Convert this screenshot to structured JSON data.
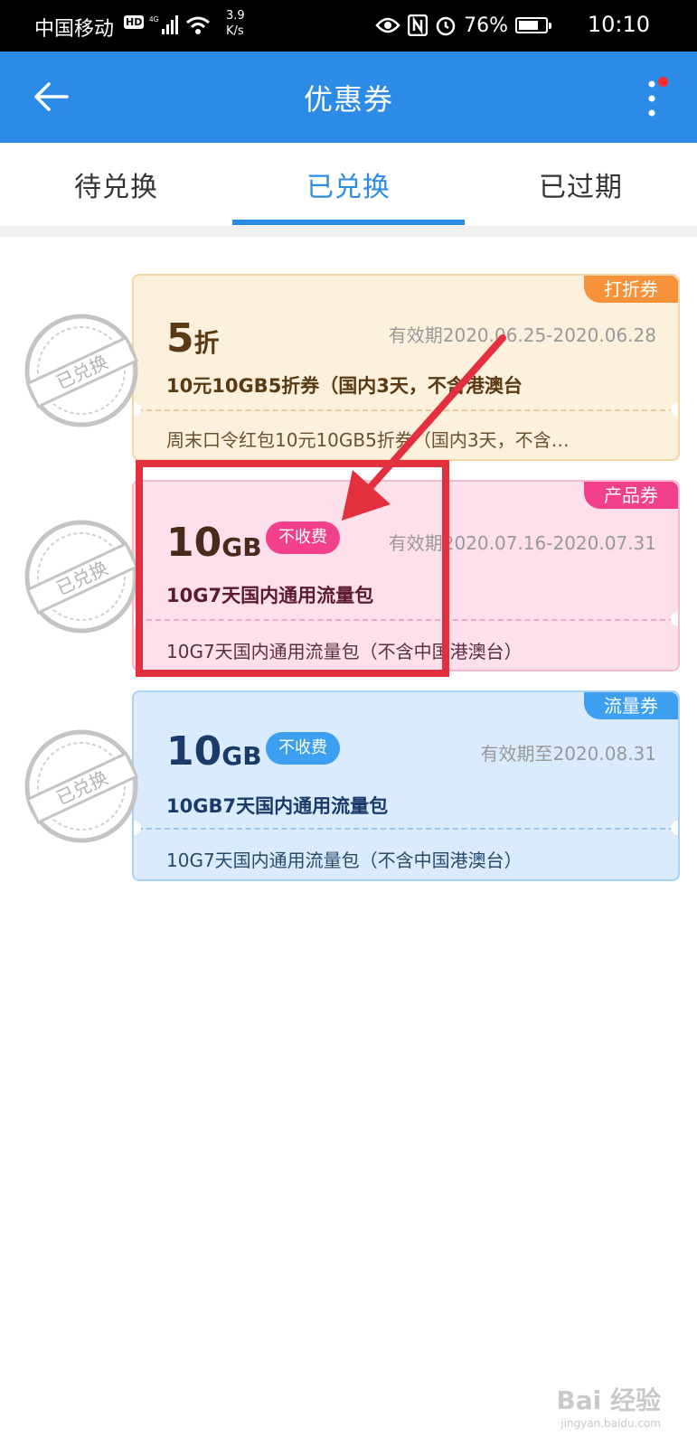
{
  "status_bar": {
    "carrier": "中国移动",
    "hd_label": "HD",
    "speed_value": "3.9",
    "speed_unit": "K/s",
    "battery": "76%",
    "battery_level": 0.76,
    "time": "10:10"
  },
  "header": {
    "title": "优惠券",
    "back_icon": "back-arrow-icon",
    "more_icon": "more-vertical-icon",
    "accent_color": "#2b8be6"
  },
  "tabs": [
    {
      "label": "待兑换",
      "active": false
    },
    {
      "label": "已兑换",
      "active": true
    },
    {
      "label": "已过期",
      "active": false
    }
  ],
  "stamp_label": "已兑换",
  "coupons": [
    {
      "tag": "打折券",
      "amount": "5",
      "amount_unit": "折",
      "badge": "",
      "validity": "有效期2020.06.25-2020.06.28",
      "name": "10元10GB5折券（国内3天，不含港澳台",
      "description": "周末口令红包10元10GB5折券（国内3天，不含…",
      "tag_color": "#f7913a",
      "bg_color": "#fdf0dd",
      "border_color": "#f5d7a5"
    },
    {
      "tag": "产品券",
      "amount": "10",
      "amount_unit": "GB",
      "badge": "不收费",
      "validity": "有效期2020.07.16-2020.07.31",
      "name": "10G7天国内通用流量包",
      "description": "10G7天国内通用流量包（不含中国港澳台）",
      "tag_color": "#f2408a",
      "bg_color": "#fde0ec",
      "border_color": "#f7b9d2"
    },
    {
      "tag": "流量券",
      "amount": "10",
      "amount_unit": "GB",
      "badge": "不收费",
      "validity": "有效期至2020.08.31",
      "name": "10GB7天国内通用流量包",
      "description": "10G7天国内通用流量包（不含中国港澳台）",
      "tag_color": "#3d9ff0",
      "bg_color": "#d9ebfc",
      "border_color": "#a9d2f7"
    }
  ],
  "watermark": {
    "brand": "Bai 经验",
    "url": "jingyan.baidu.com"
  }
}
